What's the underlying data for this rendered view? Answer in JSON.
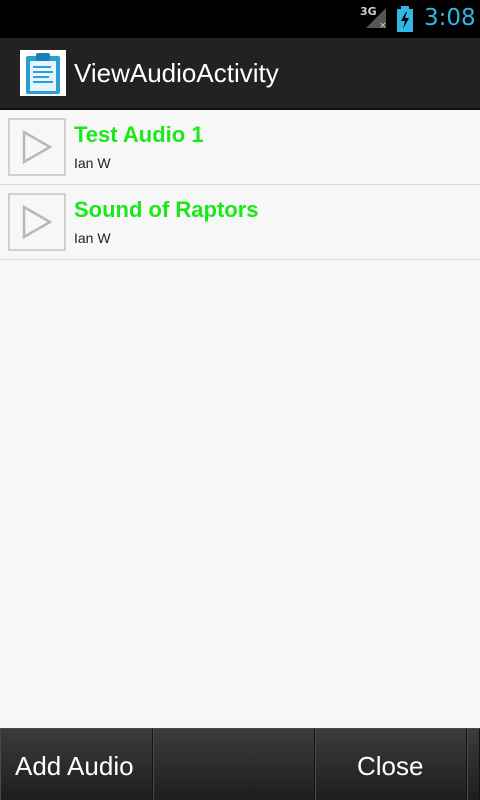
{
  "status_bar": {
    "network": "3G",
    "time": "3:08",
    "accent": "#33b5e5"
  },
  "action_bar": {
    "title": "ViewAudioActivity",
    "icon": "clipboard-icon"
  },
  "audio_list": {
    "items": [
      {
        "title": "Test Audio 1",
        "author": "Ian W",
        "icon": "play-icon"
      },
      {
        "title": "Sound of Raptors",
        "author": "Ian W",
        "icon": "play-icon"
      }
    ],
    "title_color": "#1be81b"
  },
  "bottom_bar": {
    "add_label": "Add Audio",
    "close_label": "Close"
  }
}
